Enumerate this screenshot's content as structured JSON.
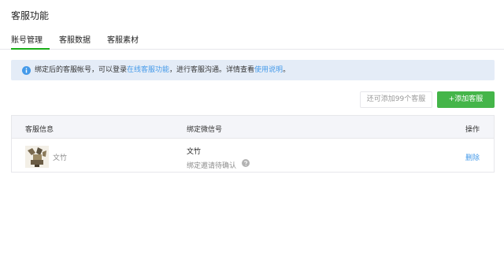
{
  "page": {
    "title": "客服功能"
  },
  "tabs": [
    {
      "label": "账号管理",
      "active": true
    },
    {
      "label": "客服数据",
      "active": false
    },
    {
      "label": "客服素材",
      "active": false
    }
  ],
  "notice": {
    "text_before": "绑定后的客服帐号，可以登录",
    "link1": "在线客服功能",
    "text_middle": "，进行客服沟通。详情查看",
    "link2": "使用说明",
    "text_after": "。"
  },
  "actions": {
    "quota_text": "还可添加99个客服",
    "add_button": "+添加客服"
  },
  "table": {
    "headers": [
      "客服信息",
      "绑定微信号",
      "操作"
    ],
    "rows": [
      {
        "account_name": "文竹",
        "wechat_name": "文竹",
        "status": "绑定邀请待确认",
        "action": "删除"
      }
    ]
  },
  "colors": {
    "accent_green": "#44b549",
    "link_blue": "#459ae9",
    "notice_bg": "#e4ecf7",
    "header_bg": "#f4f5f9"
  }
}
